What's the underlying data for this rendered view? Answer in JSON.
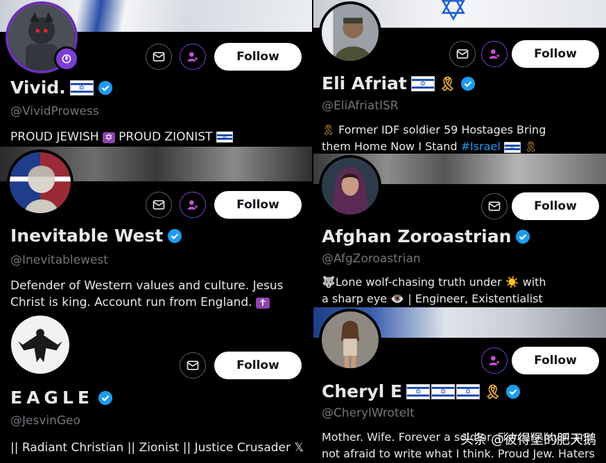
{
  "accent": "#1d9bf0",
  "cards": {
    "vivid": {
      "name": "Vivid.",
      "handle": "@VividProwess",
      "bio_1": "PROUD JEWISH ",
      "bio_2": " PROUD ZIONIST ",
      "follow": "Follow"
    },
    "eli": {
      "name": "Eli Afriat",
      "handle": "@EliAfriatISR",
      "bio_line1": " Former IDF soldier  59 Hostages  Bring",
      "bio_line2a": "them Home Now  I Stand ",
      "bio_hashtag": "#Israel",
      "follow": "Follow"
    },
    "inevitable": {
      "name": "Inevitable West",
      "handle": "@Inevitablewest",
      "bio_line1": "Defender of Western values and culture. Jesus",
      "bio_line2": "Christ is king. Account run from England. ",
      "follow": "Follow"
    },
    "afghan": {
      "name": "Afghan Zoroastrian",
      "handle": "@AfgZoroastrian",
      "bio_line1": "Lone wolf-chasing truth under ☀️ with",
      "bio_line2": "a sharp eye 👁️ | Engineer, Existentialist",
      "follow": "Follow"
    },
    "eagle": {
      "name": "EAGLE",
      "handle": "@JesvinGeo",
      "bio": "|| Radiant Christian || Zionist || Justice Crusader 𝕏",
      "follow": "Follow"
    },
    "cheryl": {
      "name": "Cheryl E",
      "handle": "@CherylWroteIt",
      "bio_line1": "Mother. Wife. Forever a soldier. Fiercely loyal and",
      "bio_line2": "not afraid to write what I think. Proud Jew. Haters",
      "follow": "Follow"
    }
  },
  "watermark": "头条 @彼得堡的肥天鹅"
}
